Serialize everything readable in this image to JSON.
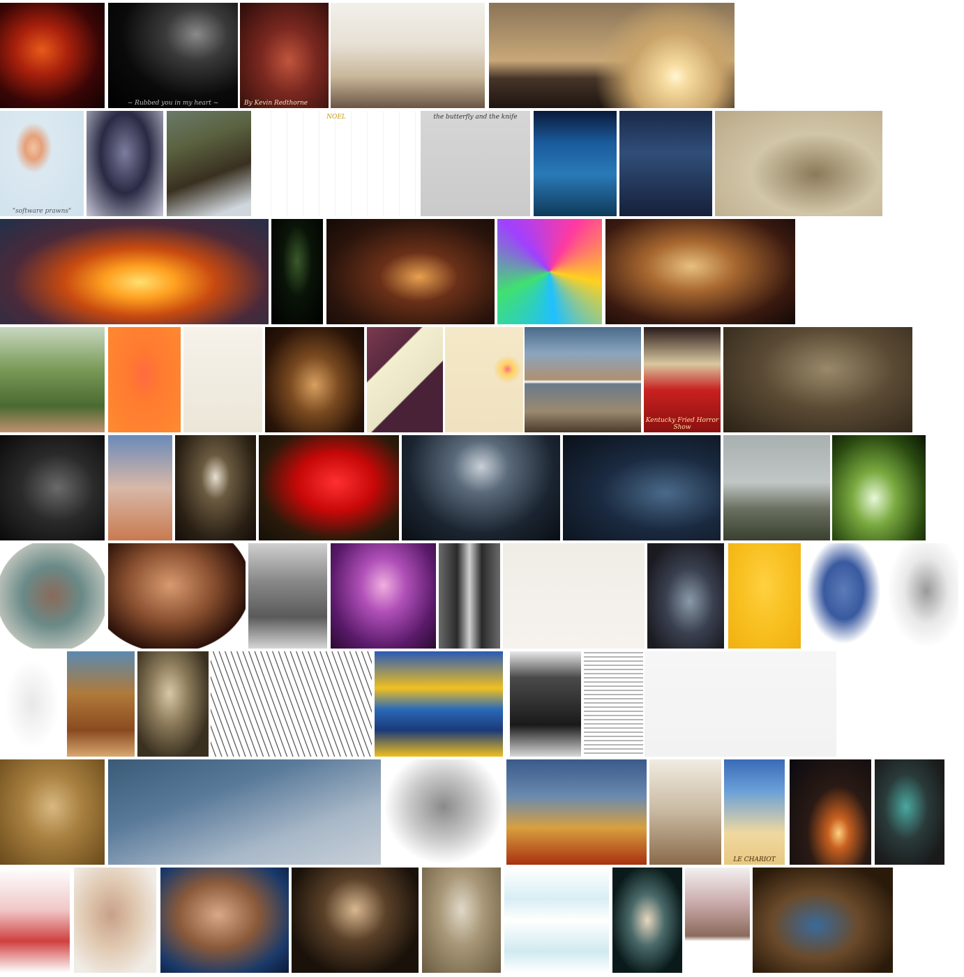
{
  "gallery": {
    "title": "",
    "rows": [
      [
        {
          "id": "r1-1",
          "bg": "radial-gradient(ellipse at 40% 45%, #e85a1a 0%, #a8200c 30%, #3a0606 65%, #120202 100%)"
        },
        {
          "id": "r1-2",
          "bg": "radial-gradient(ellipse at 68% 30%, #8a8a8a 0%, #3a3a3a 25%, #0a0a0a 60%, #000 100%)",
          "caption": "~ Rubbed you in my heart ~",
          "captionColor": "#bbbbbb"
        },
        {
          "id": "r1-3",
          "bg": "radial-gradient(ellipse at 55% 55%, #c0553c 0%, #7a2820 40%, #2a0c08 100%)",
          "caption": "By Kevin Redthorne",
          "captionColor": "#f0e0c0",
          "captionAlign": "left"
        },
        {
          "id": "r1-4",
          "bg": "linear-gradient(180deg, #f2f0ea 0%, #e6e0d4 40%, #c9b79a 70%, #6a5544 100%)"
        },
        {
          "id": "r1-5",
          "bg": "radial-gradient(circle at 76% 70%, #fff6d6 0%, #f7dca0 6%, #c9a46a 22%, transparent 40%), linear-gradient(180deg, #8a7458 0%, #c8a878 55%, #463428 72%, #1e1510 100%)"
        }
      ],
      [
        {
          "id": "r2-1",
          "bg": "radial-gradient(ellipse at 40% 35%, #f2c49e 0%, #e6a07a 12%, #dbe8f0 26%, #cfe2ee 100%)",
          "caption": "\"software prawns\"",
          "captionColor": "#555555"
        },
        {
          "id": "r2-2",
          "bg": "radial-gradient(ellipse at 50% 40%, #7c7c9e 0%, #2a2a44 45%, #c8c8d8 100%)"
        },
        {
          "id": "r2-3",
          "bg": "linear-gradient(160deg, #6a7a6a 0%, #5a6240 30%, #3a3020 60%, #cfd6dc 90%)"
        },
        {
          "id": "r2-4",
          "bg": "repeating-linear-gradient(90deg, #ffffff 0px, #ffffff 22px, #e2e4ee 23px), #ffffff",
          "caption": "NOEL",
          "captionColor": "#c89a10",
          "captionAlign": "top"
        },
        {
          "id": "r2-5",
          "bg": "linear-gradient(180deg, #d6d6d6 0%, #cacaca 100%)",
          "caption": "the butterfly and the knife",
          "captionColor": "#333333",
          "captionAlign": "top"
        },
        {
          "id": "r2-6",
          "bg": "linear-gradient(180deg, #0a1a3a 0%, #1a5a9a 30%, #2a7ab8 60%, #0e3a5a 100%)"
        },
        {
          "id": "r2-7",
          "bg": "linear-gradient(180deg, #1a2a4a 0%, #304e78 40%, #16203a 100%)"
        },
        {
          "id": "r2-8",
          "bg": "radial-gradient(ellipse at 60% 60%, #8a7a5a 0%, #d2c6a8 45%, #b8a888 100%)"
        }
      ],
      [
        {
          "id": "r3-1",
          "bg": "radial-gradient(ellipse at 52% 60%, #ffe070 0%, #ffa020 18%, #c84a10 38%, #4a2a3a 65%, #20304a 100%)"
        },
        {
          "id": "r3-2",
          "bg": "radial-gradient(ellipse at 50% 40%, #3a5a2a 0%, #0a1408 40%, #000 100%)"
        },
        {
          "id": "r3-3",
          "bg": "radial-gradient(ellipse at 55% 55%, #e8a050 0%, #6a3018 30%, #2a140c 70%, #140a06 100%)"
        },
        {
          "id": "r3-4",
          "bg": "conic-gradient(from 30deg at 50% 50%, #ff3aa0, #ffd020, #20c0ff, #40e070, #a040ff, #ff3aa0)"
        },
        {
          "id": "r3-5",
          "bg": "radial-gradient(ellipse at 45% 45%, #e8c080 0%, #a86830 30%, #3a1a10 70%, #120806 100%)"
        }
      ],
      [
        {
          "id": "r4-1",
          "bg": "linear-gradient(180deg, #c8d8c0 0%, #7a9a58 40%, #4a6a30 75%, #c09070 100%)"
        },
        {
          "id": "r4-2",
          "bg": "radial-gradient(ellipse at 50% 45%, #ff6a40 0%, #ff7a30 30%, #ff8a30 100%)"
        },
        {
          "id": "r4-3",
          "bg": "linear-gradient(180deg, #f6f2ea 0%, #ece6d8 100%)"
        },
        {
          "id": "r4-4",
          "bg": "radial-gradient(ellipse at 50% 55%, #d8a060 0%, #7a4a20 35%, #2a1408 75%, #140a04 100%)"
        },
        {
          "id": "r4-5",
          "bg": "linear-gradient(135deg, #7a3a4e 0%, #5a2a3e 30%, #f2eed0 31%, #e8e4c4 60%, #4a2238 61%)"
        },
        {
          "id": "r4-6",
          "bg": "radial-gradient(circle at 80% 40%, #ff6a8a 0%, #ffd060 6%, transparent 16%), linear-gradient(180deg, #f4e8c8 0%, #f0e2c0 100%)"
        },
        {
          "id": "r4-7",
          "bg": "linear-gradient(180deg, #4a6a8a 0%, #8aa6be 25%, #b09070 50%, #ffffff 52%, #6a7a88 54%, #9a8a70 80%, #4a3a2a 100%)"
        },
        {
          "id": "r4-8",
          "bg": "linear-gradient(180deg, #2a1a1a 0%, #d8c8a0 35%, #c82020 60%, #8a1010 100%)",
          "caption": "Kentucky Fried Horror Show",
          "captionColor": "#ffe0a0"
        },
        {
          "id": "r4-9",
          "bg": "radial-gradient(ellipse at 55% 40%, #9a8a6a 0%, #5a4a34 45%, #2a2216 100%)"
        }
      ],
      [
        {
          "id": "r5-1",
          "bg": "radial-gradient(ellipse at 55% 50%, #6a6a6a 0%, #2a2a2a 45%, #0a0a0a 100%)"
        },
        {
          "id": "r5-2",
          "bg": "linear-gradient(180deg, #6a8ab8 0%, #d8b8a8 50%, #c87a50 100%)"
        },
        {
          "id": "r5-3",
          "bg": "radial-gradient(ellipse at 50% 40%, #e8e0d0 0%, #6a5a40 25%, #2a2014 70%, #140e08 100%)"
        },
        {
          "id": "r5-4",
          "bg": "radial-gradient(ellipse at 55% 45%, #ff3030 0%, #c80808 35%, #2a1a0a 70%, #141008 100%)"
        },
        {
          "id": "r5-5",
          "bg": "radial-gradient(ellipse at 50% 30%, #c8d0d8 0%, #5a6a7a 25%, #1a2430 65%, #0a0e14 100%)"
        },
        {
          "id": "r5-6",
          "bg": "radial-gradient(ellipse at 65% 55%, #4a6a8a 0%, #1a2a40 45%, #0a1018 100%)"
        },
        {
          "id": "r5-7",
          "bg": "linear-gradient(180deg, #a8b0b0 0%, #c0c6c4 45%, #6a7060 70%, #3a4030 100%)"
        },
        {
          "id": "r5-8",
          "bg": "radial-gradient(ellipse at 45% 60%, #e8f8d8 0%, #7aaa40 30%, #2a4a10 70%, #0a1404 100%)"
        }
      ],
      [
        {
          "id": "r6-1",
          "bg": "radial-gradient(ellipse at 50% 50%, #8a6a5a 0%, #6a8a88 40%, #b8c0b8 75%, #ffffff 76%)"
        },
        {
          "id": "r6-2",
          "bg": "radial-gradient(ellipse at 45% 40%, #d89a70 0%, #8a5030 40%, #2a1008 75%, #ffffff 76%)"
        },
        {
          "id": "r6-3",
          "bg": "linear-gradient(180deg, #d0d0d0 0%, #8a8a8a 35%, #5a5a5a 70%, #d6d6d6 100%)"
        },
        {
          "id": "r6-4",
          "bg": "radial-gradient(ellipse at 50% 40%, #f0b0e0 0%, #b050b8 30%, #5a1a6a 70%, #2a0a30 100%)"
        },
        {
          "id": "r6-5",
          "bg": "linear-gradient(90deg, #6a6a6a 0%, #2a2a2a 30%, #d0d0d0 50%, #2a2a2a 70%, #6a6a6a 100%)"
        },
        {
          "id": "r6-6",
          "bg": "linear-gradient(180deg, #f0ece6 0%, #f6f2ee 100%)"
        },
        {
          "id": "r6-7",
          "bg": "radial-gradient(ellipse at 55% 55%, #8a9aa8 0%, #3a4050 40%, #1a1a20 80%)"
        },
        {
          "id": "r6-8",
          "bg": "radial-gradient(ellipse at 50% 40%, #ffd040 0%, #f8c020 50%, #f0b010 100%)"
        },
        {
          "id": "r6-9",
          "bg": "radial-gradient(ellipse at 50% 45%, #5a7ab8 0%, #3a5aa0 35%, #ffffff 65%)"
        },
        {
          "id": "r6-10",
          "bg": "radial-gradient(ellipse at 55% 45%, #9a9a9a 0%, #e8e8e8 40%, #ffffff 70%)"
        }
      ],
      [
        {
          "id": "r7-1",
          "bg": "radial-gradient(ellipse at 50% 50%, #e8e8e8 0%, #ffffff 60%)"
        },
        {
          "id": "r7-2",
          "bg": "linear-gradient(180deg, #5a8ab0 0%, #b07a3a 40%, #8a4a20 75%, #d8a870 100%)"
        },
        {
          "id": "r7-3",
          "bg": "radial-gradient(ellipse at 45% 40%, #d8c8a8 0%, #8a7a5a 35%, #3a3020 75%)"
        },
        {
          "id": "r7-4",
          "bg": "repeating-linear-gradient(70deg, #ffffff 0px, #ffffff 6px, #2a2a2a 7px, #ffffff 8px), #ffffff"
        },
        {
          "id": "r7-5",
          "bg": "linear-gradient(180deg, #2a5ab8 0%, #f0c020 35%, #2a6ab8 55%, #1a3a78 75%, #f0c020 100%)"
        },
        {
          "id": "r7-6",
          "bg": "linear-gradient(180deg, #e8e8e8 0%, #4a4a4a 25%, #1a1a1a 70%, #d8d8d8 100%)"
        },
        {
          "id": "r7-7",
          "bg": "repeating-linear-gradient(0deg, #ffffff 0px, #ffffff 4px, #6a6a6a 5px, #ffffff 6px), #ffffff"
        },
        {
          "id": "r7-8",
          "bg": "linear-gradient(180deg, #f6f6f6 0%, #f2f2f2 100%)"
        }
      ],
      [
        {
          "id": "r8-1",
          "bg": "radial-gradient(ellipse at 50% 45%, #d8b880 0%, #a88040 40%, #6a4a1a 100%)"
        },
        {
          "id": "r8-2",
          "bg": "linear-gradient(160deg, #3a5a78 0%, #5a7a9a 35%, #a8b8c8 70%, #c8d0d8 100%)"
        },
        {
          "id": "r8-3",
          "bg": "radial-gradient(ellipse at 50% 45%, #8a8a8a 0%, #c8c8c8 40%, #ffffff 70%)"
        },
        {
          "id": "r8-4",
          "bg": "linear-gradient(180deg, #3a5a8a 0%, #6a8ab0 35%, #d8a040 65%, #a83010 100%)"
        },
        {
          "id": "r8-5",
          "bg": "linear-gradient(180deg, #f0ece2 0%, #c8b8a0 50%, #8a6a4a 100%)"
        },
        {
          "id": "r8-6",
          "bg": "linear-gradient(180deg, #3a6ab8 0%, #6aa0d8 30%, #f0d8a0 70%, #e8c880 100%)",
          "caption": "LE CHARIOT",
          "captionColor": "#3a2a10"
        },
        {
          "id": "r8-7",
          "bg": "radial-gradient(ellipse at 60% 70%, #ffd080 0%, #c86020 15%, #2a1a14 45%, #0a0a10 100%)"
        },
        {
          "id": "r8-8",
          "bg": "radial-gradient(ellipse at 45% 45%, #4aa8a0 0%, #2a3a3a 40%, #1a1a1a 80%)"
        }
      ],
      [
        {
          "id": "r9-1",
          "bg": "linear-gradient(180deg, #ffffff 0%, #f0c8c8 40%, #d04040 70%, #ffffff 100%)"
        },
        {
          "id": "r9-2",
          "bg": "radial-gradient(ellipse at 45% 45%, #c8a088 0%, #e0c8b0 40%, #f0ece6 80%)"
        },
        {
          "id": "r9-3",
          "bg": "radial-gradient(ellipse at 45% 45%, #d8a888 0%, #8a5a3a 40%, #1a3a6a 75%, #0a1a3a 100%)"
        },
        {
          "id": "r9-4",
          "bg": "radial-gradient(ellipse at 50% 40%, #d8b890 0%, #5a4028 35%, #1a120a 75%)"
        },
        {
          "id": "r9-5",
          "bg": "radial-gradient(ellipse at 50% 40%, #e0d8c8 0%, #a89878 40%, #6a5a40 100%)"
        },
        {
          "id": "r9-6",
          "bg": "linear-gradient(180deg, #ffffff 0%, #d8eef4 30%, #ffffff 50%, #d0eaf0 80%, #ffffff 100%)"
        },
        {
          "id": "r9-7",
          "bg": "radial-gradient(ellipse at 50% 50%, #e8d8c0 0%, #4a6a6a 35%, #0a1a1a 75%)"
        },
        {
          "id": "r9-8",
          "bg": "linear-gradient(180deg, #f4f0f0 0%, #c8a8a8 35%, #8a6a5a 65%, #ffffff 70%)"
        },
        {
          "id": "r9-9",
          "bg": "radial-gradient(ellipse at 45% 55%, #3a6a9a 0%, #6a4a2a 40%, #2a1a0a 80%)"
        }
      ]
    ]
  }
}
